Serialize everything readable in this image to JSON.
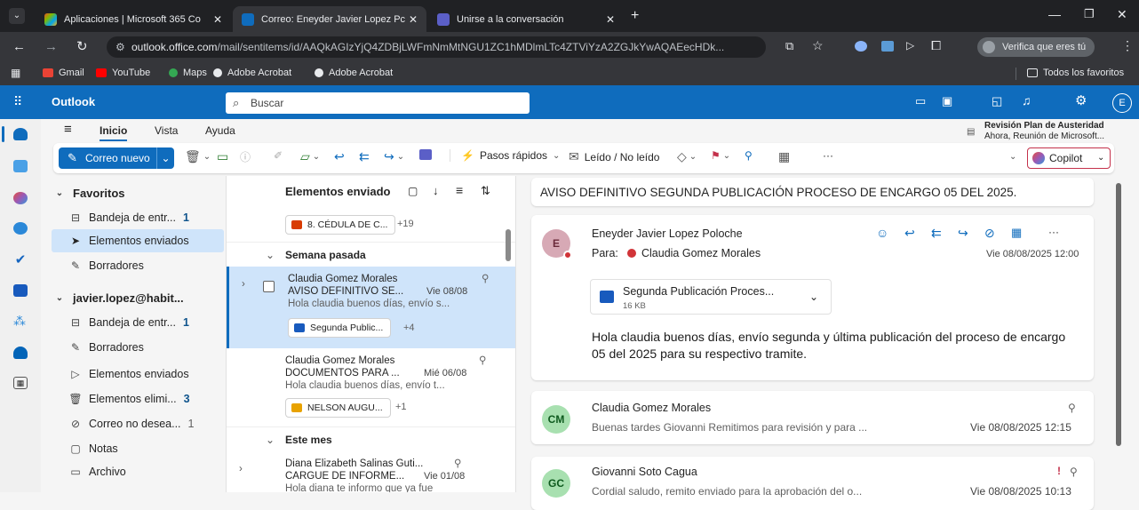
{
  "browser": {
    "tabs": [
      {
        "title": "Aplicaciones | Microsoft 365 Co",
        "active": false
      },
      {
        "title": "Correo: Eneyder Javier Lopez Pc",
        "active": true
      },
      {
        "title": "Unirse a la conversación",
        "active": false
      }
    ],
    "url_host": "outlook.office.com",
    "url_path": "/mail/sentitems/id/AAQkAGIzYjQ4ZDBjLWFmNmMtNGU1ZC1hMDlmLTc4ZTViYzA2ZGJkYwAQAEecHDk...",
    "verify_label": "Verifica que eres tú",
    "bookmarks": [
      "Gmail",
      "YouTube",
      "Maps",
      "Adobe Acrobat",
      "Adobe Acrobat"
    ],
    "all_favorites": "Todos los favoritos"
  },
  "app": {
    "name": "Outlook",
    "search_placeholder": "Buscar",
    "avatar_initial": "E",
    "brand_color": "#0f6cbd"
  },
  "ribbon": {
    "tabs": [
      "Inicio",
      "Vista",
      "Ayuda"
    ],
    "new_mail": "Correo nuevo",
    "quick_steps": "Pasos rápidos",
    "read_unread": "Leído / No leído",
    "more": "···",
    "copilot": "Copilot",
    "reminder_title": "Revisión Plan de Austeridad",
    "reminder_sub": "Ahora, Reunión de Microsoft..."
  },
  "folders": {
    "favorites_title": "Favoritos",
    "favorites": [
      {
        "label": "Bandeja de entr...",
        "count": "1",
        "icon": "inbox-icon"
      },
      {
        "label": "Elementos enviados",
        "count": "",
        "icon": "send-icon",
        "selected": true
      },
      {
        "label": "Borradores",
        "count": "",
        "icon": "drafts-icon"
      }
    ],
    "account_title": "javier.lopez@habit...",
    "account": [
      {
        "label": "Bandeja de entr...",
        "count": "1",
        "icon": "inbox-icon"
      },
      {
        "label": "Borradores",
        "count": "",
        "icon": "drafts-icon"
      },
      {
        "label": "Elementos enviados",
        "count": "",
        "icon": "send-icon"
      },
      {
        "label": "Elementos elimi...",
        "count": "3",
        "icon": "trash-icon"
      },
      {
        "label": "Correo no desea...",
        "count": "1",
        "icon": "junk-icon"
      },
      {
        "label": "Notas",
        "count": "",
        "icon": "notes-icon"
      },
      {
        "label": "Archivo",
        "count": "",
        "icon": "archive-icon"
      }
    ]
  },
  "list": {
    "title": "Elementos enviado",
    "top_chip": "8. CÉDULA DE C...",
    "top_more": "+19",
    "section_last_week": "Semana pasada",
    "section_month": "Este mes",
    "items": [
      {
        "sender": "Claudia Gomez Morales",
        "subject": "AVISO DEFINITIVO SE...",
        "date": "Vie 08/08",
        "preview": "Hola claudia buenos días, envío s...",
        "chip": "Segunda Public...",
        "more": "+4"
      },
      {
        "sender": "Claudia Gomez Morales",
        "subject": "DOCUMENTOS PARA ...",
        "date": "Mié 06/08",
        "preview": "Hola claudia buenos días, envío t...",
        "chip": "NELSON AUGU...",
        "more": "+1"
      },
      {
        "sender": "Diana Elizabeth Salinas Guti...",
        "subject": "CARGUE DE INFORME...",
        "date": "Vie 01/08",
        "preview": "Hola diana te informo que ya fue"
      }
    ]
  },
  "reading": {
    "subject": "AVISO DEFINITIVO SEGUNDA PUBLICACIÓN PROCESO DE ENCARGO 05 DEL 2025.",
    "from": "Eneyder Javier Lopez Poloche",
    "from_initial": "E",
    "to_label": "Para:",
    "to": "Claudia Gomez Morales",
    "date": "Vie 08/08/2025 12:00",
    "attachment_name": "Segunda Publicación Proces...",
    "attachment_size": "16 KB",
    "body": "Hola claudia buenos días, envío segunda y última publicación del proceso de encargo 05 del 2025 para su respectivo tramite.",
    "thread": [
      {
        "initials": "CM",
        "sender": "Claudia Gomez Morales",
        "preview": "Buenas tardes Giovanni Remitimos para revisión y para ...",
        "date": "Vie 08/08/2025 12:15"
      },
      {
        "initials": "GC",
        "sender": "Giovanni Soto Cagua",
        "preview": "Cordial saludo, remito enviado para la aprobación del o...",
        "date": "Vie 08/08/2025 10:13"
      }
    ]
  }
}
